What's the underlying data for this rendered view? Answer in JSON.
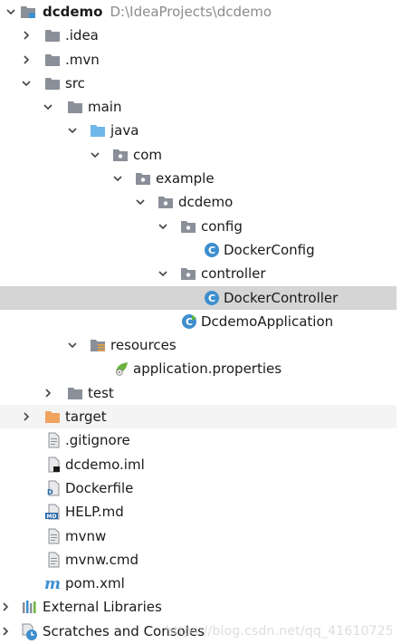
{
  "project": {
    "name": "dcdemo",
    "path": "D:\\IdeaProjects\\dcdemo"
  },
  "tree": {
    "idea": ".idea",
    "mvn": ".mvn",
    "src": "src",
    "main": "main",
    "java": "java",
    "com": "com",
    "example": "example",
    "dcdemo_pkg": "dcdemo",
    "config": "config",
    "docker_config": "DockerConfig",
    "controller": "controller",
    "docker_controller": "DockerController",
    "dcdemo_application": "DcdemoApplication",
    "resources": "resources",
    "application_properties": "application.properties",
    "test": "test",
    "target": "target",
    "gitignore": ".gitignore",
    "dcdemo_iml": "dcdemo.iml",
    "dockerfile": "Dockerfile",
    "help_md": "HELP.md",
    "mvnw": "mvnw",
    "mvnw_cmd": "mvnw.cmd",
    "pom_xml": "pom.xml",
    "external_libraries": "External Libraries",
    "scratches": "Scratches and Consoles"
  },
  "icons": {
    "file_type_letters": {
      "dockerfile": "D",
      "help_md": "MD",
      "pom": "m",
      "class": "C"
    }
  },
  "watermark": "https://blog.csdn.net/qq_41610725",
  "colors": {
    "folder_gray": "#8a8f99",
    "folder_source_blue": "#6fb7e8",
    "folder_excluded_orange": "#f0a35e",
    "class_icon": "#3d8fce",
    "selection_bg": "#d5d5d5",
    "path_gray": "#8c8c8c"
  }
}
